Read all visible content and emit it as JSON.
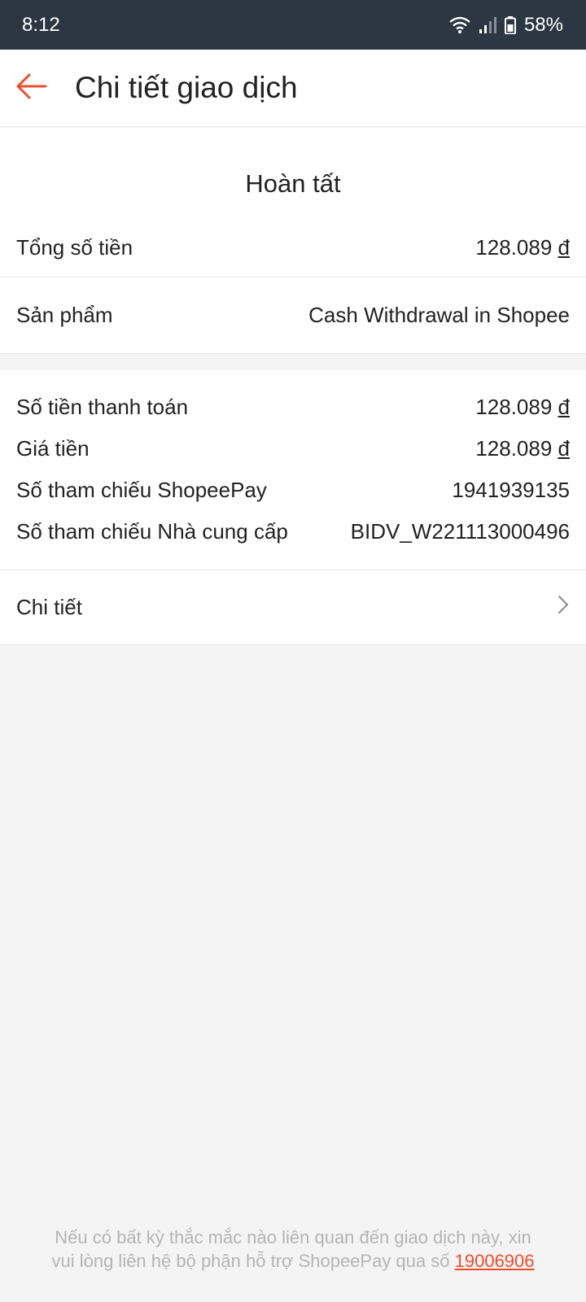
{
  "status_bar": {
    "time": "8:12",
    "battery": "58%"
  },
  "header": {
    "title": "Chi tiết giao dịch"
  },
  "summary": {
    "status": "Hoàn tất",
    "total_label": "Tổng số tiền",
    "total_amount": "128.089",
    "currency": "đ"
  },
  "product": {
    "label": "Sản phẩm",
    "value": "Cash Withdrawal in Shopee"
  },
  "details": [
    {
      "label": "Số tiền thanh toán",
      "value": "128.089",
      "currency": "đ"
    },
    {
      "label": "Giá tiền",
      "value": "128.089",
      "currency": "đ"
    },
    {
      "label": "Số tham chiếu ShopeePay",
      "value": "1941939135"
    },
    {
      "label": "Số tham chiếu Nhà cung cấp",
      "value": "BIDV_W221113000496"
    }
  ],
  "more": {
    "label": "Chi tiết"
  },
  "footer": {
    "line1": "Nếu có bất kỳ thắc mắc nào liên quan đến giao dịch này, xin",
    "line2": "vui lòng liên hệ bộ phận hỗ trợ ShopeePay qua số",
    "phone": "19006906"
  },
  "colors": {
    "accent": "#ee4d2d",
    "status_bar": "#2d3743",
    "background": "#f4f4f4"
  }
}
